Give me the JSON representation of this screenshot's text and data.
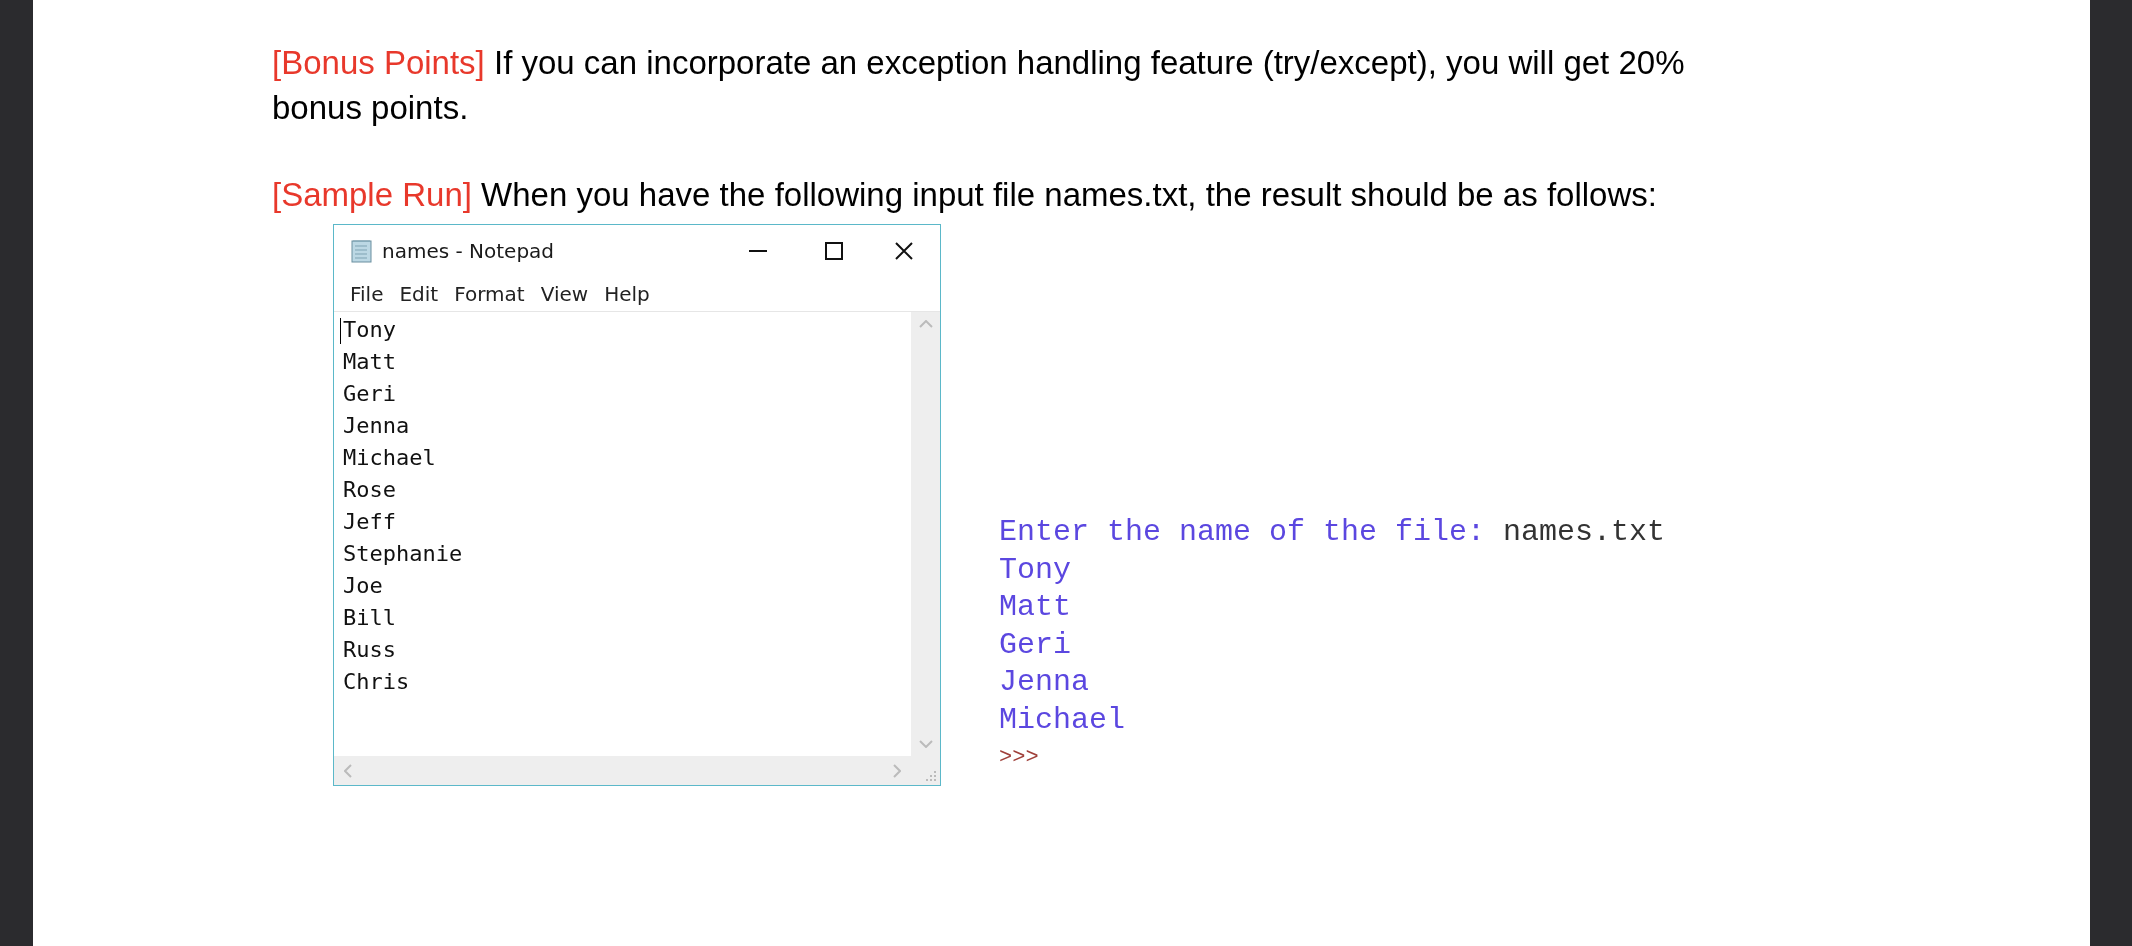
{
  "paragraphs": [
    {
      "tag": "[Bonus Points]",
      "text": "If you can incorporate an exception handling feature (try/except), you will get 20% bonus points."
    },
    {
      "tag": "[Sample Run]",
      "text": "When you have the following input file names.txt, the result should be as follows:"
    }
  ],
  "notepad": {
    "title": "names - Notepad",
    "menu": [
      "File",
      "Edit",
      "Format",
      "View",
      "Help"
    ],
    "lines": [
      "Tony",
      "Matt",
      "Geri",
      "Jenna",
      "Michael",
      "Rose",
      "Jeff",
      "Stephanie",
      "Joe",
      "Bill",
      "Russ",
      "Chris"
    ]
  },
  "console": [
    {
      "kind": "prompt",
      "prompt": "Enter the name of the file:",
      "input": "names.txt"
    },
    {
      "kind": "output",
      "text": "Tony"
    },
    {
      "kind": "output",
      "text": "Matt"
    },
    {
      "kind": "output",
      "text": "Geri"
    },
    {
      "kind": "output",
      "text": "Jenna"
    },
    {
      "kind": "output",
      "text": "Michael"
    },
    {
      "kind": "shell_prompt",
      "text": ">>>"
    }
  ]
}
